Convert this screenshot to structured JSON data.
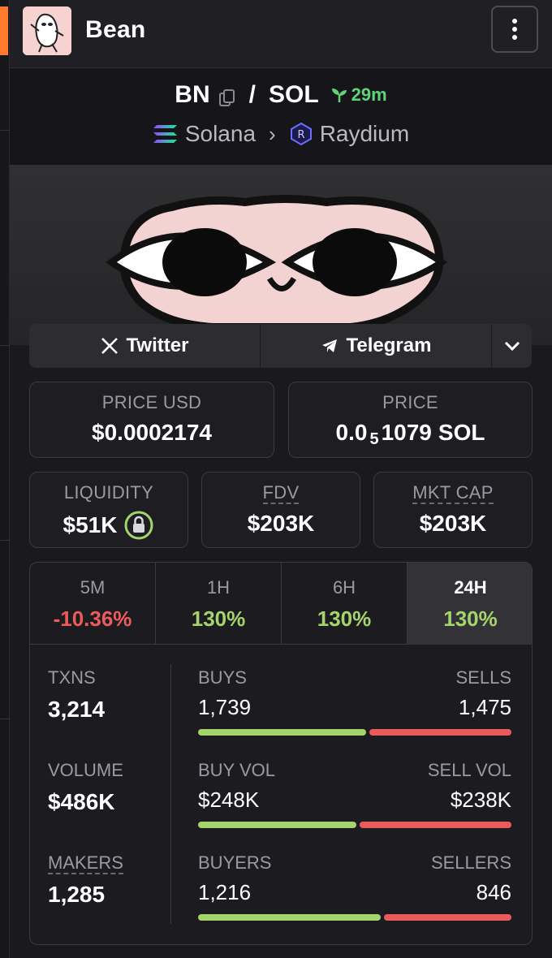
{
  "app": {
    "name": "Bean"
  },
  "pair": {
    "base": "BN",
    "separator": "/",
    "quote": "SOL",
    "age": "29m"
  },
  "chain": {
    "network": "Solana",
    "dex": "Raydium"
  },
  "socials": {
    "twitter": "Twitter",
    "telegram": "Telegram"
  },
  "price_usd": {
    "label": "PRICE USD",
    "value": "$0.0002174"
  },
  "price_native": {
    "label": "PRICE",
    "prefix": "0.0",
    "zeros": "5",
    "digits": "1079",
    "unit": "SOL"
  },
  "liquidity": {
    "label": "LIQUIDITY",
    "value": "$51K"
  },
  "fdv": {
    "label": "FDV",
    "value": "$203K"
  },
  "mkt_cap": {
    "label": "MKT CAP",
    "value": "$203K"
  },
  "periods": [
    {
      "label": "5M",
      "change": "-10.36%"
    },
    {
      "label": "1H",
      "change": "130%"
    },
    {
      "label": "6H",
      "change": "130%"
    },
    {
      "label": "24H",
      "change": "130%"
    }
  ],
  "active_period": "24H",
  "stats": {
    "txns": {
      "label": "TXNS",
      "value": "3,214"
    },
    "volume": {
      "label": "VOLUME",
      "value": "$486K"
    },
    "makers": {
      "label": "MAKERS",
      "value": "1,285"
    }
  },
  "ratios": [
    {
      "left_label": "BUYS",
      "left_value": "1,739",
      "right_label": "SELLS",
      "right_value": "1,475",
      "buy_fraction": 0.541
    },
    {
      "left_label": "BUY VOL",
      "left_value": "$248K",
      "right_label": "SELL VOL",
      "right_value": "$238K",
      "buy_fraction": 0.51
    },
    {
      "left_label": "BUYERS",
      "left_value": "1,216",
      "right_label": "SELLERS",
      "right_value": "846",
      "buy_fraction": 0.59
    }
  ],
  "colors": {
    "positive": "#a4d46b",
    "negative": "#ec5b5b",
    "age": "#5fd27a"
  }
}
